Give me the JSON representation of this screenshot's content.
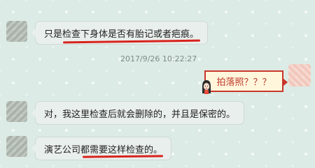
{
  "chat": {
    "messages": [
      {
        "sender": "other",
        "text": "只是检查下身体是否有胎记或者疤痕。"
      },
      {
        "sender": "self",
        "text": "拍落照？？？",
        "timestamp": "2017/9/26 10:22:27"
      },
      {
        "sender": "other",
        "text": "对，我这里检查后就会删除的，并且是保密的。"
      },
      {
        "sender": "other",
        "text": "演艺公司都需要这样检查的。"
      }
    ]
  },
  "colors": {
    "background": "#dcebe5",
    "bubble": "#e9efec",
    "annotation_red": "#d8231d",
    "sent_bubble_fill": "#fff6dc",
    "sent_text": "#c0392b"
  },
  "icons": [
    "contact-avatar-icon",
    "user-avatar-icon",
    "woman-face-icon"
  ]
}
